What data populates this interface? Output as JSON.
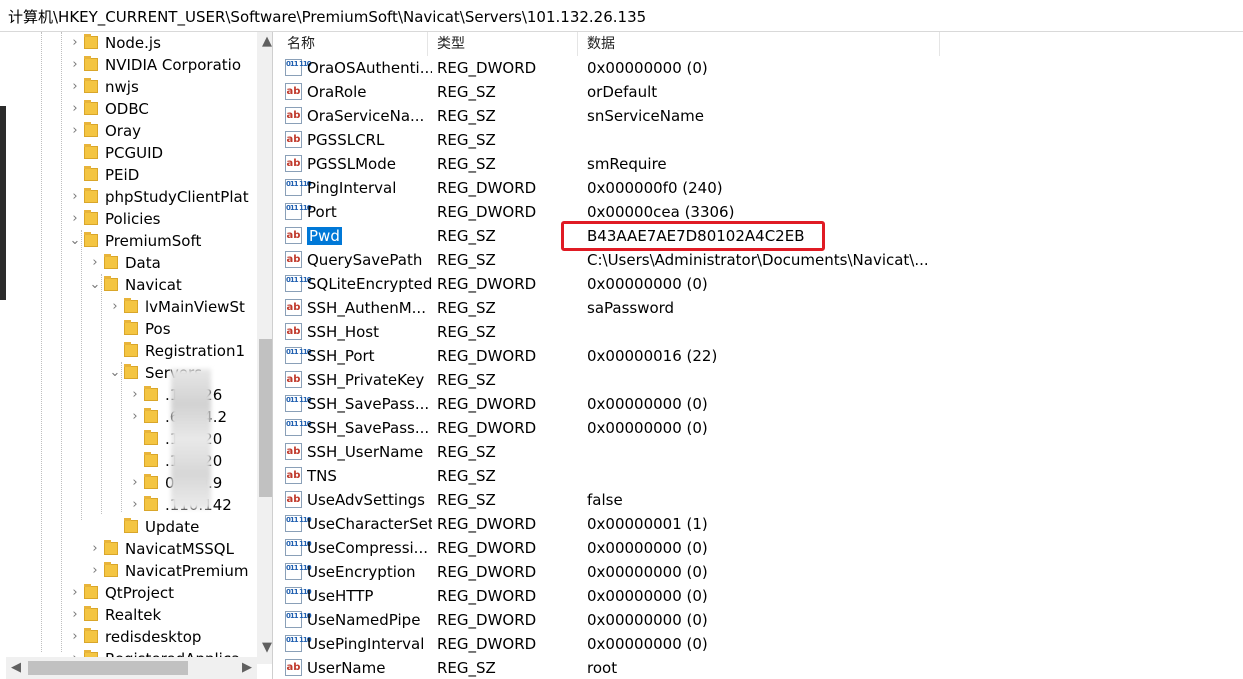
{
  "address_path": "计算机\\HKEY_CURRENT_USER\\Software\\PremiumSoft\\Navicat\\Servers\\101.132.26.135",
  "tree": {
    "items": [
      {
        "label": "Node.js",
        "chev": "›"
      },
      {
        "label": "NVIDIA Corporatio",
        "chev": "›"
      },
      {
        "label": "nwjs",
        "chev": "›"
      },
      {
        "label": "ODBC",
        "chev": "›"
      },
      {
        "label": "Oray",
        "chev": "›"
      },
      {
        "label": "PCGUID",
        "chev": ""
      },
      {
        "label": "PEiD",
        "chev": ""
      },
      {
        "label": "phpStudyClientPlat",
        "chev": "›"
      },
      {
        "label": "Policies",
        "chev": "›"
      },
      {
        "label": "PremiumSoft",
        "chev": "⌄"
      },
      {
        "label": "Data",
        "chev": "›"
      },
      {
        "label": "Navicat",
        "chev": "⌄"
      },
      {
        "label": "lvMainViewSt",
        "chev": "›"
      },
      {
        "label": "Pos",
        "chev": ""
      },
      {
        "label": "Registration1",
        "chev": ""
      },
      {
        "label": "Servers",
        "chev": "⌄"
      },
      {
        "label": ".132.26",
        "chev": "›"
      },
      {
        "label": ".62.64.2",
        "chev": "›"
      },
      {
        "label": ".152.20",
        "chev": ""
      },
      {
        "label": ".152.20",
        "chev": ""
      },
      {
        "label": "04.90.9",
        "chev": "›"
      },
      {
        "label": ".110.142",
        "chev": "›"
      },
      {
        "label": "Update",
        "chev": ""
      },
      {
        "label": "NavicatMSSQL",
        "chev": "›"
      },
      {
        "label": "NavicatPremium",
        "chev": "›"
      },
      {
        "label": "QtProject",
        "chev": "›"
      },
      {
        "label": "Realtek",
        "chev": "›"
      },
      {
        "label": "redisdesktop",
        "chev": "›"
      },
      {
        "label": "RegisteredApplica",
        "chev": "›"
      }
    ]
  },
  "columns": {
    "name": "名称",
    "type": "类型",
    "data": "数据"
  },
  "values": [
    {
      "name": "OraOSAuthenti...",
      "type": "REG_DWORD",
      "data": "0x00000000 (0)",
      "icon": "dword"
    },
    {
      "name": "OraRole",
      "type": "REG_SZ",
      "data": "orDefault",
      "icon": "sz"
    },
    {
      "name": "OraServiceNa...",
      "type": "REG_SZ",
      "data": "snServiceName",
      "icon": "sz"
    },
    {
      "name": "PGSSLCRL",
      "type": "REG_SZ",
      "data": "",
      "icon": "sz"
    },
    {
      "name": "PGSSLMode",
      "type": "REG_SZ",
      "data": "smRequire",
      "icon": "sz"
    },
    {
      "name": "PingInterval",
      "type": "REG_DWORD",
      "data": "0x000000f0 (240)",
      "icon": "dword"
    },
    {
      "name": "Port",
      "type": "REG_DWORD",
      "data": "0x00000cea (3306)",
      "icon": "dword"
    },
    {
      "name": "Pwd",
      "type": "REG_SZ",
      "data": "B43AAE7AE7D80102A4C2EB",
      "icon": "sz",
      "selected": true
    },
    {
      "name": "QuerySavePath",
      "type": "REG_SZ",
      "data": "C:\\Users\\Administrator\\Documents\\Navicat\\...",
      "icon": "sz"
    },
    {
      "name": "SQLiteEncrypted",
      "type": "REG_DWORD",
      "data": "0x00000000 (0)",
      "icon": "dword"
    },
    {
      "name": "SSH_AuthenM...",
      "type": "REG_SZ",
      "data": "saPassword",
      "icon": "sz"
    },
    {
      "name": "SSH_Host",
      "type": "REG_SZ",
      "data": "",
      "icon": "sz"
    },
    {
      "name": "SSH_Port",
      "type": "REG_DWORD",
      "data": "0x00000016 (22)",
      "icon": "dword"
    },
    {
      "name": "SSH_PrivateKey",
      "type": "REG_SZ",
      "data": "",
      "icon": "sz"
    },
    {
      "name": "SSH_SavePass...",
      "type": "REG_DWORD",
      "data": "0x00000000 (0)",
      "icon": "dword"
    },
    {
      "name": "SSH_SavePass...",
      "type": "REG_DWORD",
      "data": "0x00000000 (0)",
      "icon": "dword"
    },
    {
      "name": "SSH_UserName",
      "type": "REG_SZ",
      "data": "",
      "icon": "sz"
    },
    {
      "name": "TNS",
      "type": "REG_SZ",
      "data": "",
      "icon": "sz"
    },
    {
      "name": "UseAdvSettings",
      "type": "REG_SZ",
      "data": "false",
      "icon": "sz"
    },
    {
      "name": "UseCharacterSet",
      "type": "REG_DWORD",
      "data": "0x00000001 (1)",
      "icon": "dword"
    },
    {
      "name": "UseCompressi...",
      "type": "REG_DWORD",
      "data": "0x00000000 (0)",
      "icon": "dword"
    },
    {
      "name": "UseEncryption",
      "type": "REG_DWORD",
      "data": "0x00000000 (0)",
      "icon": "dword"
    },
    {
      "name": "UseHTTP",
      "type": "REG_DWORD",
      "data": "0x00000000 (0)",
      "icon": "dword"
    },
    {
      "name": "UseNamedPipe",
      "type": "REG_DWORD",
      "data": "0x00000000 (0)",
      "icon": "dword"
    },
    {
      "name": "UsePingInterval",
      "type": "REG_DWORD",
      "data": "0x00000000 (0)",
      "icon": "dword"
    },
    {
      "name": "UserName",
      "type": "REG_SZ",
      "data": "root",
      "icon": "sz"
    }
  ],
  "icon_glyphs": {
    "sz": "ab",
    "dword": "011 110"
  },
  "colors": {
    "selection": "#0078d7",
    "highlight_box": "#e01b24",
    "folder": "#f4c542"
  }
}
